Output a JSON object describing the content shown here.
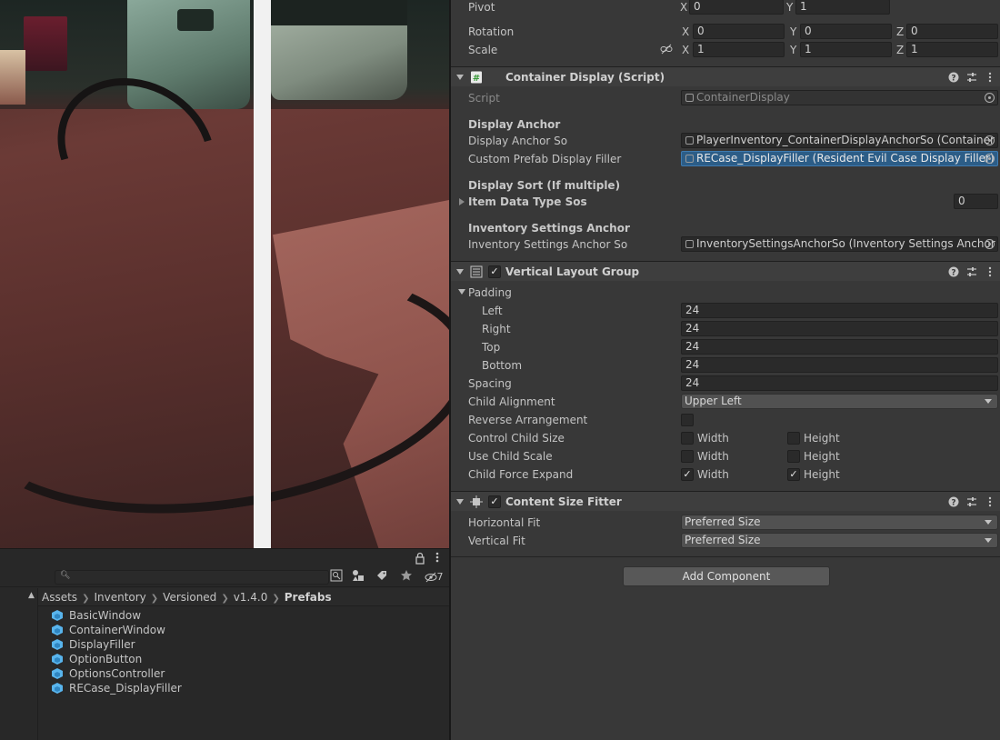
{
  "project": {
    "breadcrumb": [
      "Assets",
      "Inventory",
      "Versioned",
      "v1.4.0",
      "Prefabs"
    ],
    "files": [
      "BasicWindow",
      "ContainerWindow",
      "DisplayFiller",
      "OptionButton",
      "OptionsController",
      "RECase_DisplayFiller"
    ],
    "hidden_count": "7",
    "search_value": ""
  },
  "inspector": {
    "transform": {
      "pivot_label": "Pivot",
      "pivot": {
        "x": "0",
        "y": "1"
      },
      "rotation_label": "Rotation",
      "rotation": {
        "x": "0",
        "y": "0",
        "z": "0"
      },
      "scale_label": "Scale",
      "scale": {
        "x": "1",
        "y": "1",
        "z": "1"
      },
      "axis": {
        "x": "X",
        "y": "Y",
        "z": "Z"
      }
    },
    "container_display": {
      "title": "Container Display (Script)",
      "script_label": "Script",
      "script_value": "ContainerDisplay",
      "section_display_anchor": "Display Anchor",
      "display_anchor_so_label": "Display Anchor So",
      "display_anchor_so_value": "PlayerInventory_ContainerDisplayAnchorSo (Container Display Anchor So)",
      "custom_prefab_label": "Custom Prefab Display Filler",
      "custom_prefab_value": "RECase_DisplayFiller (Resident Evil Case Display Filler)",
      "section_display_sort": "Display Sort (If multiple)",
      "item_data_type_label": "Item Data Type Sos",
      "item_data_type_count": "0",
      "section_inventory_settings": "Inventory Settings Anchor",
      "inventory_settings_label": "Inventory Settings Anchor So",
      "inventory_settings_value": "InventorySettingsAnchorSo (Inventory Settings Anchor So)"
    },
    "vertical_layout": {
      "title": "Vertical Layout Group",
      "padding_label": "Padding",
      "left_label": "Left",
      "left": "24",
      "right_label": "Right",
      "right": "24",
      "top_label": "Top",
      "top": "24",
      "bottom_label": "Bottom",
      "bottom": "24",
      "spacing_label": "Spacing",
      "spacing": "24",
      "child_alignment_label": "Child Alignment",
      "child_alignment": "Upper Left",
      "reverse_label": "Reverse Arrangement",
      "control_child_size_label": "Control Child Size",
      "use_child_scale_label": "Use Child Scale",
      "child_force_expand_label": "Child Force Expand",
      "width_label": "Width",
      "height_label": "Height"
    },
    "content_size_fitter": {
      "title": "Content Size Fitter",
      "horizontal_fit_label": "Horizontal Fit",
      "horizontal_fit": "Preferred Size",
      "vertical_fit_label": "Vertical Fit",
      "vertical_fit": "Preferred Size"
    },
    "add_component": "Add Component"
  },
  "colors": {
    "selected_field": "#2c5d87",
    "panel_bg": "#383838",
    "script_icon": "#4caf50"
  },
  "icons": {
    "help": "help-icon",
    "presets": "presets-icon",
    "more": "more-vert-icon",
    "lock": "lock-icon",
    "constrain": "link-icon"
  }
}
